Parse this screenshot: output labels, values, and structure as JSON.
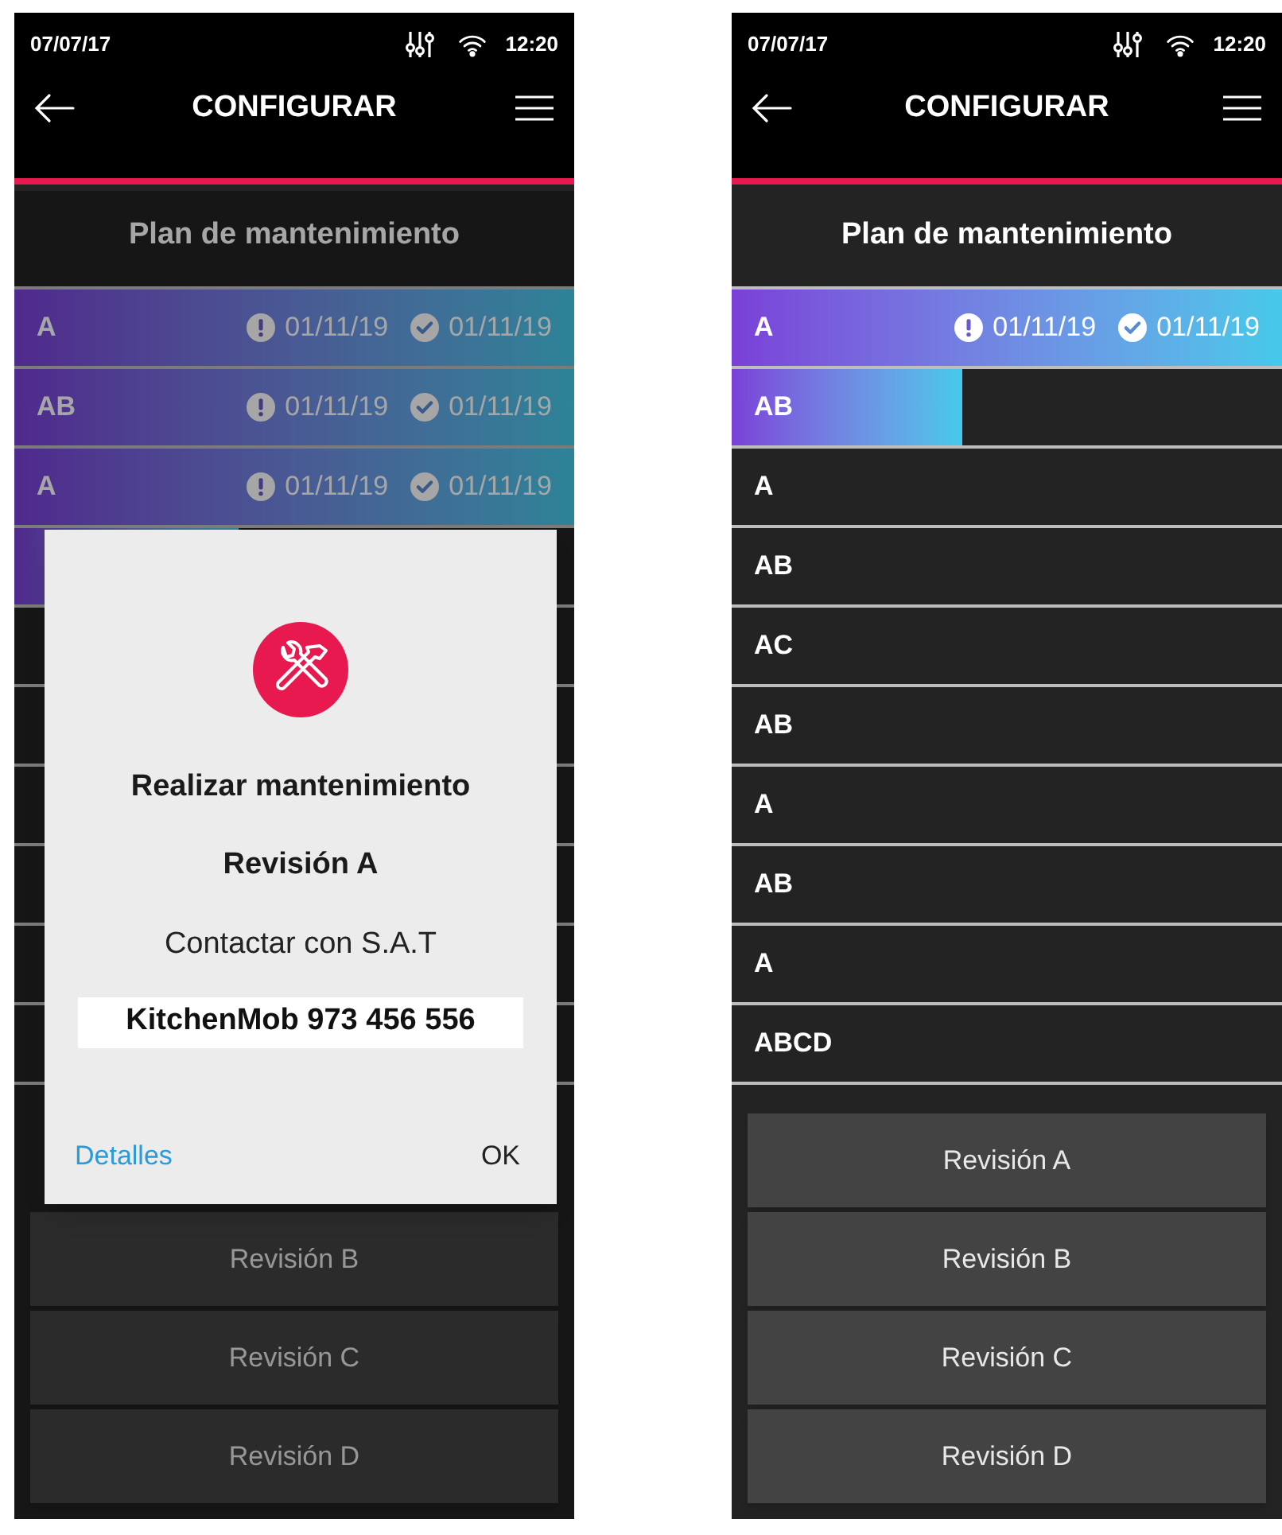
{
  "screens": [
    {
      "status_bar": {
        "date": "07/07/17",
        "time": "12:20"
      },
      "app_bar": {
        "title": "CONFIGURAR"
      },
      "section_title": "Plan de mantenimiento",
      "rows": [
        {
          "label": "A",
          "level": 1,
          "warning_date": "01/11/19",
          "done_date": "01/11/19"
        },
        {
          "label": "AB",
          "level": 1,
          "warning_date": "01/11/19",
          "done_date": "01/11/19"
        },
        {
          "label": "A",
          "level": 1,
          "warning_date": "01/11/19",
          "done_date": "01/11/19"
        },
        {
          "level": 0.4
        }
      ],
      "buttons": [
        "Revisión B",
        "Revisión C",
        "Revisión D"
      ],
      "dialog": {
        "title": "Realizar mantenimiento",
        "subtitle": "Revisión A",
        "message": "Contactar con S.A.T",
        "contact": "KitchenMob 973 456 556",
        "link": "Detalles",
        "ok": "OK"
      }
    },
    {
      "status_bar": {
        "date": "07/07/17",
        "time": "12:20"
      },
      "app_bar": {
        "title": "CONFIGURAR"
      },
      "section_title": "Plan de mantenimiento",
      "rows": [
        {
          "label": "A",
          "level": 1,
          "warning_date": "01/11/19",
          "done_date": "01/11/19"
        },
        {
          "label": "AB",
          "level": 0.42
        },
        {
          "label": "A"
        },
        {
          "label": "AB"
        },
        {
          "label": "AC"
        },
        {
          "label": "AB"
        },
        {
          "label": "A"
        },
        {
          "label": "AB"
        },
        {
          "label": "A"
        },
        {
          "label": "ABCD"
        }
      ],
      "buttons": [
        "Revisión A",
        "Revisión B",
        "Revisión C",
        "Revisión D"
      ]
    }
  ]
}
